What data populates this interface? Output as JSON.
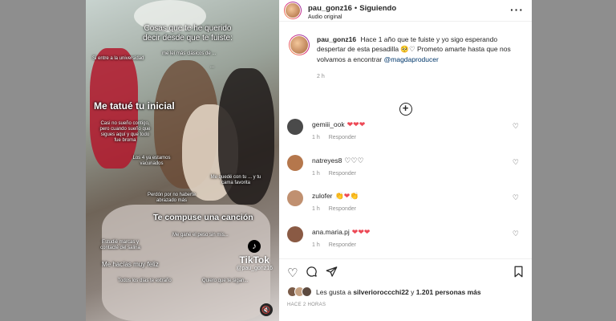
{
  "post": {
    "username": "pau_gonz16",
    "separator": "•",
    "follow_status": "Siguiendo",
    "audio_label": "Audio original",
    "caption_username": "pau_gonz16",
    "caption_text": "Hace 1 año que te fuiste y yo sigo esperando despertar de esta pesadilla 🥺♡ Prometo amarte hasta que nos volvamos a encontrar",
    "caption_mention": "@magdaproducer",
    "caption_time": "2 h"
  },
  "video_overlay": {
    "title": "Cosas que te he querido decir desde que te fuiste:",
    "lines": [
      "Si entre a la universidad",
      "me leí más clásicos de ...",
      "...",
      "Me tatué tu inicial",
      "Casi no sueño contigo, pero cuando sueño que sigues aquí y que todo fue broma",
      "Los 4 ya estamos vacunados",
      "Me quedé con tu ... y tu cama favorita",
      "Perdón por no haberte abrazado más",
      "Te compuse una canción",
      "Me gané el peso sin mis...",
      "Estudié marcas y contacté del salina",
      "Me hacías muy feliz",
      "Todos los días te extraño",
      "Quiero que te sigan..."
    ],
    "tiktok_logo": "TikTok",
    "tiktok_handle": "@pau_gonz16"
  },
  "comments": [
    {
      "username": "gemiii_ook",
      "emoji": "❤❤❤",
      "time": "1 h",
      "reply": "Responder",
      "avatar_color": "#4a4a4a"
    },
    {
      "username": "natreyes8",
      "emoji": "♡♡♡",
      "time": "1 h",
      "reply": "Responder",
      "avatar_color": "#b5774c"
    },
    {
      "username": "zulofer",
      "emoji": "👏❤👏",
      "time": "1 h",
      "reply": "Responder",
      "avatar_color": "#c09070"
    },
    {
      "username": "ana.maria.pj",
      "emoji": "❤❤❤",
      "time": "1 h",
      "reply": "Responder",
      "avatar_color": "#8a5a44"
    }
  ],
  "likes": {
    "prefix": "Les gusta a",
    "user": "silverioroccchi22",
    "middle": "y",
    "count": "1.201 personas más"
  },
  "posted_ago": "HACE 2 HORAS",
  "icons": {
    "more": "more-horizontal-icon",
    "load_more": "plus-circle-icon",
    "comment_like": "heart-outline-icon",
    "like": "heart-outline-icon",
    "comment": "comment-bubble-icon",
    "share": "paper-plane-icon",
    "save": "bookmark-icon",
    "mute": "mute-icon"
  }
}
